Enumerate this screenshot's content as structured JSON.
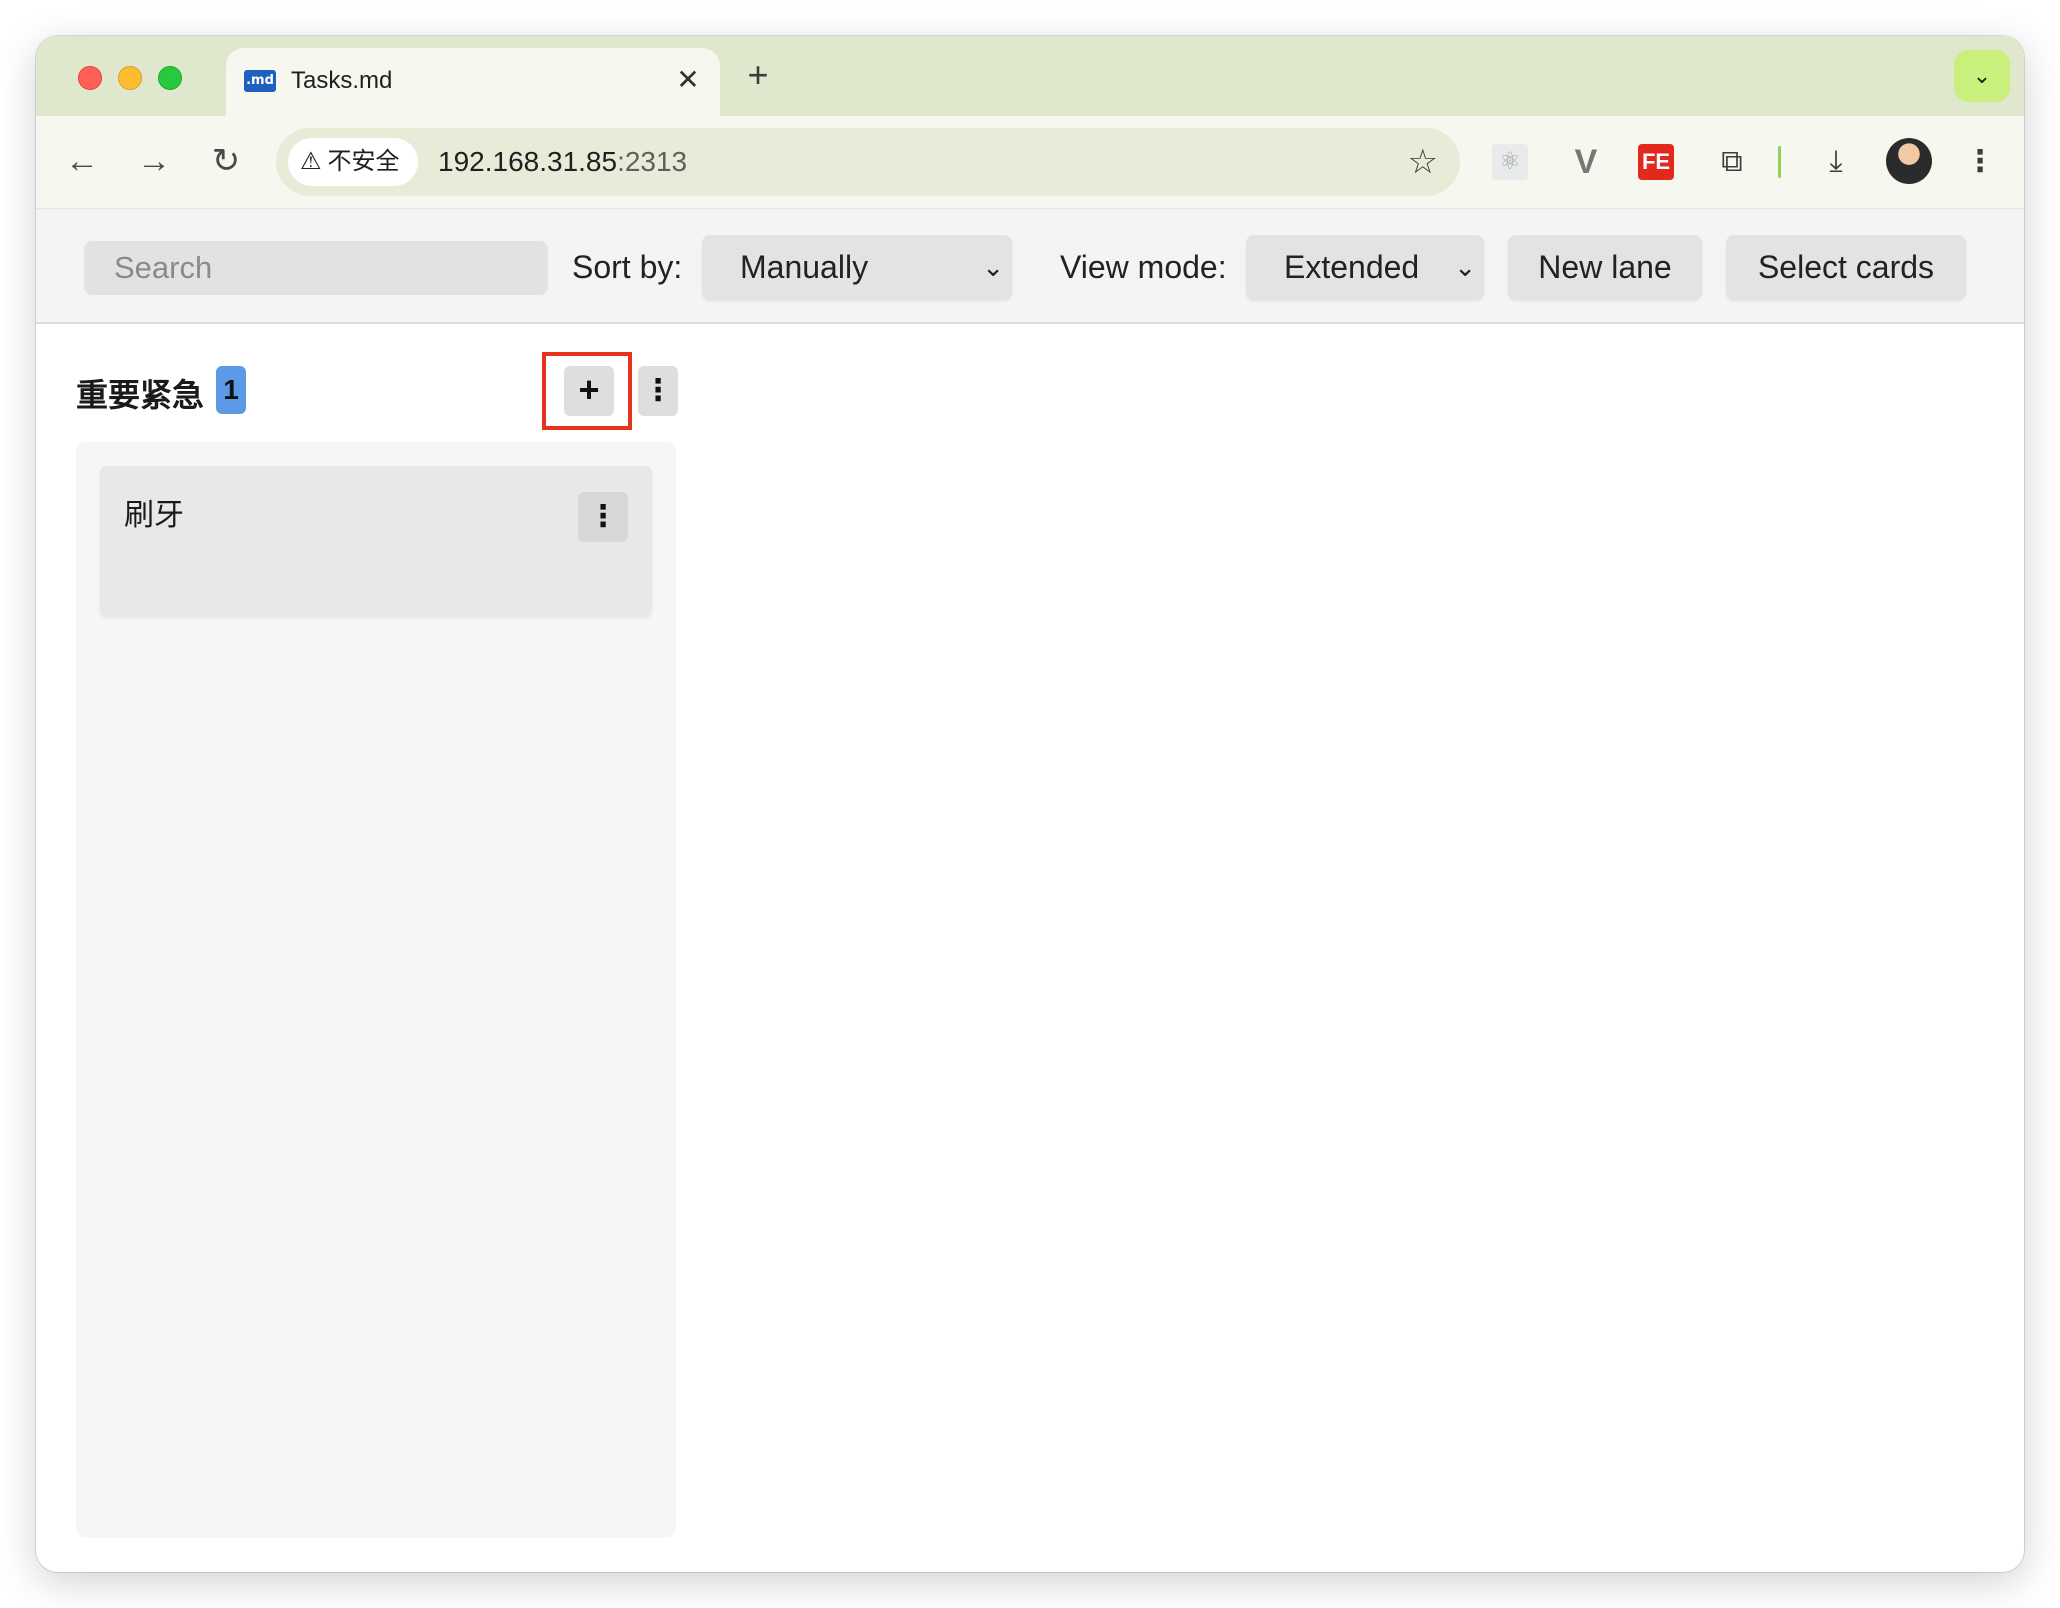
{
  "browser": {
    "tab": {
      "favicon_text": ".md",
      "title": "Tasks.md",
      "close_glyph": "✕"
    },
    "new_tab_glyph": "+",
    "tab_dropdown_glyph": "⌄",
    "nav": {
      "back": "←",
      "forward": "→",
      "reload": "↻"
    },
    "security": {
      "icon": "⚠",
      "label": "不安全"
    },
    "url": {
      "host": "192.168.31.85",
      "port": ":2313"
    },
    "bookmark_glyph": "☆",
    "extensions": [
      {
        "name": "react-devtools",
        "glyph": "⚛"
      },
      {
        "name": "vue-devtools",
        "glyph": "V"
      },
      {
        "name": "fe-helper",
        "glyph": "FE"
      },
      {
        "name": "extensions-puzzle",
        "glyph": "⧉"
      }
    ],
    "download_glyph": "⤓",
    "menu_glyph": "⋮"
  },
  "header": {
    "search_placeholder": "Search",
    "sort_label": "Sort by:",
    "sort_value": "Manually",
    "view_label": "View mode:",
    "view_value": "Extended",
    "chevron": "⌄",
    "new_lane": "New lane",
    "select_cards": "Select cards"
  },
  "lanes": [
    {
      "title": "重要紧急",
      "count": "1",
      "add_glyph": "+",
      "menu_glyph": "⋮",
      "cards": [
        {
          "title": "刷牙",
          "menu_glyph": "⋮"
        }
      ]
    }
  ],
  "colors": {
    "tabstrip": "#dfe8cc",
    "toolbar": "#f6f7ee",
    "highlight": "#e8321c",
    "count_badge": "#5c9ae8"
  }
}
